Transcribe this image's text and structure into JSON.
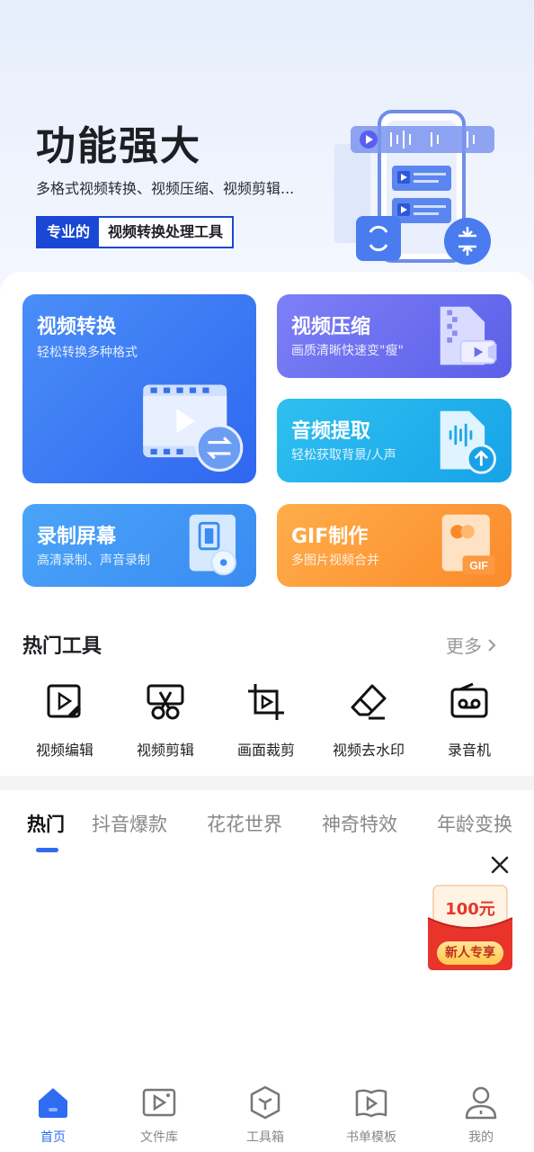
{
  "hero": {
    "title": "功能强大",
    "subtitle": "多格式视频转换、视频压缩、视频剪辑...",
    "badge_left": "专业的",
    "badge_right": "视频转换处理工具"
  },
  "features": [
    {
      "title": "视频转换",
      "subtitle": "轻松转换多种格式"
    },
    {
      "title": "视频压缩",
      "subtitle": "画质清晰快速变\"瘦\""
    },
    {
      "title": "音频提取",
      "subtitle": "轻松获取背景/人声"
    },
    {
      "title": "录制屏幕",
      "subtitle": "高清录制、声音录制"
    },
    {
      "title": "GIF制作",
      "subtitle": "多图片视频合并"
    }
  ],
  "hot_tools": {
    "title": "热门工具",
    "more": "更多",
    "items": [
      {
        "label": "视频编辑",
        "icon": "video-edit-icon"
      },
      {
        "label": "视频剪辑",
        "icon": "video-cut-icon"
      },
      {
        "label": "画面裁剪",
        "icon": "crop-icon"
      },
      {
        "label": "视频去水印",
        "icon": "eraser-icon"
      },
      {
        "label": "录音机",
        "icon": "recorder-icon"
      }
    ]
  },
  "tabs": [
    "热门",
    "抖音爆款",
    "花花世界",
    "神奇特效",
    "年龄变换"
  ],
  "red_packet": {
    "amount": "100元",
    "label": "新人专享"
  },
  "bottom_nav": [
    {
      "label": "首页",
      "icon": "home-icon",
      "active": true
    },
    {
      "label": "文件库",
      "icon": "file-library-icon"
    },
    {
      "label": "工具箱",
      "icon": "toolbox-icon"
    },
    {
      "label": "书单模板",
      "icon": "book-template-icon"
    },
    {
      "label": "我的",
      "icon": "profile-icon"
    }
  ],
  "colors": {
    "accent": "#2f6cf2",
    "badge_blue": "#1b47d6",
    "convert_card": "#3a78f4",
    "compress_card": "#6a6df0",
    "audio_card": "#22b2ee",
    "record_card": "#4298f5",
    "gif_card": "#fd9a38"
  }
}
